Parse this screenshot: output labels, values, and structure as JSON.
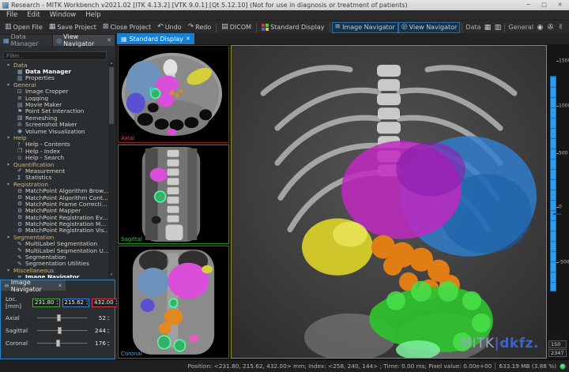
{
  "window": {
    "title": "Research - MITK Workbench v2021.02 [ITK 4.13.2] [VTK 9.0.1] [Qt 5.12.10] (Not for use in diagnosis or treatment of patients)",
    "controls": {
      "minimize": "─",
      "maximize": "□",
      "close": "✕"
    }
  },
  "icons": {
    "close": "✕",
    "dropdown_arrow": "▸",
    "spin_up": "▴",
    "spin_down": "▾",
    "tree_collapse": "▾"
  },
  "menu_bar": {
    "items": [
      "File",
      "Edit",
      "Window",
      "Help"
    ]
  },
  "toolbar": {
    "buttons": [
      {
        "id": "open-file",
        "label": "Open File",
        "icon": "folder-open"
      },
      {
        "id": "save-project",
        "label": "Save Project",
        "icon": "floppy"
      },
      {
        "id": "close-project",
        "label": "Close Project",
        "icon": "close-doc"
      },
      {
        "id": "undo",
        "label": "Undo",
        "icon": "undo-arrow"
      },
      {
        "id": "redo",
        "label": "Redo",
        "icon": "redo-arrow"
      },
      {
        "id": "dicom",
        "label": "DICOM",
        "icon": "folder"
      },
      {
        "id": "standard-display",
        "label": "Standard Display",
        "icon": "display-colors"
      },
      {
        "id": "image-navigator",
        "label": "Image Navigator",
        "icon": "sliders",
        "active": true
      },
      {
        "id": "view-navigator",
        "label": "View Navigator",
        "icon": "compass",
        "active": true
      }
    ],
    "groups": [
      {
        "label": "Data",
        "icons": [
          "table",
          "properties"
        ]
      },
      {
        "label": "General",
        "icons": [
          "eye",
          "camera",
          "hand",
          "pin",
          "video",
          "list",
          "crop"
        ]
      }
    ],
    "dropdowns": [
      "Help",
      "Quantification",
      "Registration",
      "Segmentation"
    ]
  },
  "plugin_panel": {
    "tabs": [
      {
        "label": "Data Manager",
        "icon": "table",
        "active": false,
        "closable": false
      },
      {
        "label": "View Navigator",
        "icon": "compass",
        "active": true,
        "closable": true
      }
    ],
    "filter_placeholder": "Filter...",
    "tree": [
      {
        "category": "Data",
        "items": [
          {
            "label": "Data Manager",
            "icon": "table",
            "bold": true
          },
          {
            "label": "Properties",
            "icon": "properties"
          }
        ]
      },
      {
        "category": "General",
        "items": [
          {
            "label": "Image Cropper",
            "icon": "crop"
          },
          {
            "label": "Logging",
            "icon": "list"
          },
          {
            "label": "Movie Maker",
            "icon": "film"
          },
          {
            "label": "Point Set Interaction",
            "icon": "pin"
          },
          {
            "label": "Remeshing",
            "icon": "mesh"
          },
          {
            "label": "Screenshot Maker",
            "icon": "camera"
          },
          {
            "label": "Volume Visualization",
            "icon": "eye"
          }
        ]
      },
      {
        "category": "Help",
        "items": [
          {
            "label": "Help - Contents",
            "icon": "help"
          },
          {
            "label": "Help - Index",
            "icon": "book"
          },
          {
            "label": "Help - Search",
            "icon": "search"
          }
        ]
      },
      {
        "category": "Quantification",
        "items": [
          {
            "label": "Measurement",
            "icon": "measure"
          },
          {
            "label": "Statistics",
            "icon": "stats"
          }
        ]
      },
      {
        "category": "Registration",
        "items": [
          {
            "label": "MatchPoint Algorithm Brow...",
            "icon": "gear"
          },
          {
            "label": "MatchPoint Algorithm Cont...",
            "icon": "gear"
          },
          {
            "label": "MatchPoint Frame Correcti...",
            "icon": "gear"
          },
          {
            "label": "MatchPoint Mapper",
            "icon": "gear"
          },
          {
            "label": "MatchPoint Registration Ev...",
            "icon": "gear"
          },
          {
            "label": "MatchPoint Registration M...",
            "icon": "gear"
          },
          {
            "label": "MatchPoint Registration Vis...",
            "icon": "gear"
          }
        ]
      },
      {
        "category": "Segmentation",
        "items": [
          {
            "label": "MultiLabel Segmentation",
            "icon": "seg"
          },
          {
            "label": "MultiLabel Segmentation U...",
            "icon": "seg"
          },
          {
            "label": "Segmentation",
            "icon": "seg"
          },
          {
            "label": "Segmentation Utilities",
            "icon": "seg"
          }
        ]
      },
      {
        "category": "Miscellaneous",
        "items": [
          {
            "label": "Image Navigator",
            "icon": "sliders",
            "bold": true
          }
        ]
      }
    ]
  },
  "image_navigator": {
    "tab_label": "Image Navigator",
    "loc_label": "Loc. [mm]",
    "loc_values": [
      {
        "value": "231.80",
        "color": "#3fae3f"
      },
      {
        "value": "215.62",
        "color": "#3f7fdf"
      },
      {
        "value": "432.00",
        "color": "#cf3f3f"
      }
    ],
    "sliders": [
      {
        "label": "Axial",
        "value": "52"
      },
      {
        "label": "Sagittal",
        "value": "244"
      },
      {
        "label": "Coronal",
        "value": "176"
      }
    ]
  },
  "editor": {
    "tab_label": "Standard Display",
    "views": [
      {
        "name": "axial",
        "label": "Axial",
        "border_color": "#8e1f1f",
        "label_color": "#e04545"
      },
      {
        "name": "sagittal",
        "label": "Sagittal",
        "border_color": "#1f8e1f",
        "label_color": "#3fbf3f"
      },
      {
        "name": "coronal",
        "label": "Coronal",
        "border_color": "#2057c8",
        "label_color": "#5aa0e0"
      },
      {
        "name": "3d",
        "label": "",
        "border_color": "#8f8f23",
        "label_color": ""
      }
    ],
    "logo": {
      "mitk": "MITK",
      "sep": "|",
      "dkfz": "dkfz."
    },
    "level_window": {
      "scale_labels": [
        "1500",
        "1000",
        "500",
        "0",
        "-500"
      ],
      "level": "150",
      "window": "2347"
    }
  },
  "status_bar": {
    "position_text": "Position: <231.80, 215.62, 432.00> mm; Index: <258, 240, 144> ; Time: 0.00 ms; Pixel value: 0.00e+00",
    "memory_text": "633.19 MB (3.88 %)"
  }
}
